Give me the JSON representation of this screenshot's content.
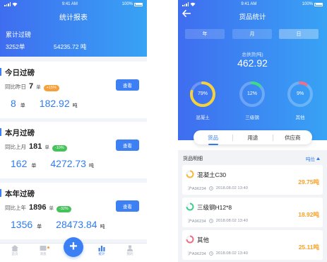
{
  "left": {
    "status": {
      "time": "9:41 AM",
      "battery": "100%"
    },
    "title": "统计报表",
    "cumulative": {
      "label": "累计过磅",
      "count": "3252单",
      "weight": "54235.72 吨"
    },
    "cards": [
      {
        "title": "今日过磅",
        "compare_label": "同比昨日",
        "compare_value": "7",
        "compare_unit": "单",
        "change": "+15%",
        "change_color": "#f7a03a",
        "button": "查看",
        "orders": "8",
        "orders_unit": "单",
        "weight": "182.92",
        "weight_unit": "吨"
      },
      {
        "title": "本月过磅",
        "compare_label": "同比上月",
        "compare_value": "181",
        "compare_unit": "单",
        "change": "-10%",
        "change_color": "#46c25a",
        "button": "查看",
        "orders": "162",
        "orders_unit": "单",
        "weight": "4272.73",
        "weight_unit": "吨"
      },
      {
        "title": "本年过磅",
        "compare_label": "同比上年",
        "compare_value": "1896",
        "compare_unit": "单",
        "change": "-32%",
        "change_color": "#46c25a",
        "button": "查看",
        "orders": "1356",
        "orders_unit": "单",
        "weight": "28473.84",
        "weight_unit": "吨"
      }
    ],
    "tabbar": {
      "items": [
        {
          "label": "首页",
          "icon": "home-icon"
        },
        {
          "label": "消息",
          "icon": "message-icon"
        },
        {
          "label": "统计",
          "icon": "chart-icon",
          "active": true
        },
        {
          "label": "我的",
          "icon": "user-icon"
        }
      ],
      "fab": "+"
    }
  },
  "right": {
    "status": {
      "time": "9:41 AM",
      "battery": "100%"
    },
    "title": "货品统计",
    "periods": [
      {
        "label": "年"
      },
      {
        "label": "月"
      },
      {
        "label": "日",
        "active": true
      }
    ],
    "total": {
      "label": "总供货(吨)",
      "value": "462.92"
    },
    "rings": [
      {
        "name": "混凝土",
        "percent": "79%",
        "fraction": 0.79,
        "color": "#f6d23a"
      },
      {
        "name": "三级钢",
        "percent": "12%",
        "fraction": 0.12,
        "color": "#3ddc84"
      },
      {
        "name": "其他",
        "percent": "9%",
        "fraction": 0.09,
        "color": "#f26d86"
      }
    ],
    "segments": [
      {
        "label": "货品",
        "active": true
      },
      {
        "label": "用途"
      },
      {
        "label": "供应商"
      }
    ],
    "detail": {
      "title": "货品明细",
      "unit": "吨位",
      "items": [
        {
          "name": "混凝土C30",
          "plate": "沪A96234",
          "time": "2018.08.02 13:40",
          "amount": "29.75吨",
          "color": "#f6b93a"
        },
        {
          "name": "三级钢H12*8",
          "plate": "沪A96234",
          "time": "2018.08.02 13:40",
          "amount": "18.92吨",
          "color": "#3ccf8e"
        },
        {
          "name": "其他",
          "plate": "沪A96234",
          "time": "2018.08.02 13:40",
          "amount": "25.11吨",
          "color": "#f26d86"
        }
      ]
    }
  }
}
